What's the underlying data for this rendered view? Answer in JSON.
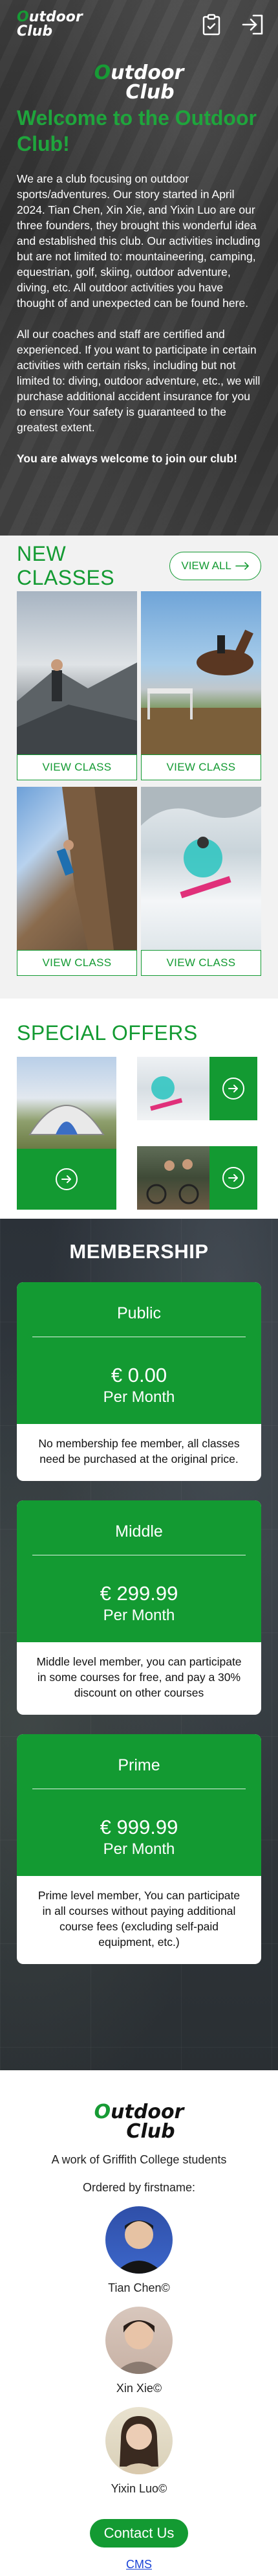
{
  "header": {
    "logo_line1_first": "O",
    "logo_line1_rest": "utdoor",
    "logo_line2": "Club",
    "icons": [
      "clipboard-icon",
      "logout-icon"
    ]
  },
  "hero": {
    "logo_line1_first": "O",
    "logo_line1_rest": "utdoor",
    "logo_line2": "Club",
    "title": "Welcome to the Outdoor Club!",
    "paragraph1": "We are a club focusing on outdoor sports/adventures. Our story started in April 2024. Tian Chen, Xin Xie, and Yixin Luo are our three founders, they brought this wonderful idea and established this club. Our activities including but are not limited to: mountaineering, camping, equestrian, golf, skiing, outdoor adventure, diving, etc. All outdoor activities you have thought of and unexpected can be found here.",
    "paragraph2": "All our coaches and staff are certified and experienced. If you want to participate in certain activities with certain risks, including but not limited to: diving, outdoor adventure, etc., we will purchase additional accident insurance for you to ensure Your safety is guaranteed to the greatest extent.",
    "paragraph3": "You are always welcome to join our club!"
  },
  "classes": {
    "title": "NEW CLASSES",
    "view_all": "VIEW ALL",
    "items": [
      {
        "button": "VIEW CLASS"
      },
      {
        "button": "VIEW CLASS"
      },
      {
        "button": "VIEW CLASS"
      },
      {
        "button": "VIEW CLASS"
      }
    ]
  },
  "offers": {
    "title": "SPECIAL OFFERS"
  },
  "membership": {
    "title": "MEMBERSHIP",
    "plans": [
      {
        "name": "Public",
        "price": "€ 0.00",
        "per": "Per Month",
        "desc": "No membership fee member, all classes need be purchased at the original price."
      },
      {
        "name": "Middle",
        "price": "€ 299.99",
        "per": "Per Month",
        "desc": "Middle level member, you can participate in some courses for free, and pay a 30% discount on other courses"
      },
      {
        "name": "Prime",
        "price": "€ 999.99",
        "per": "Per Month",
        "desc": "Prime level member, You can participate in all courses without paying additional course fees (excluding self-paid equipment, etc.)"
      }
    ]
  },
  "footer": {
    "logo_line1_first": "O",
    "logo_line1_rest": "utdoor",
    "logo_line2": "Club",
    "subtitle": "A work of Griffith College students",
    "order_note": "Ordered by firstname:",
    "people": [
      {
        "name": "Tian Chen©"
      },
      {
        "name": "Xin Xie©"
      },
      {
        "name": "Yixin Luo©"
      }
    ],
    "contact": "Contact Us",
    "cms": "CMS"
  },
  "colors": {
    "brand_green": "#139a32",
    "link_blue": "#1a44d6"
  }
}
